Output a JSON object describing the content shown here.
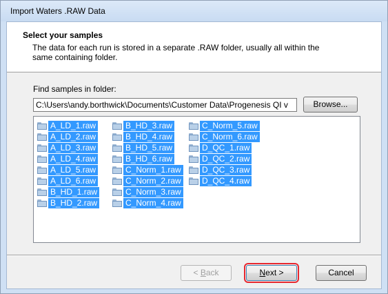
{
  "window": {
    "title": "Import Waters .RAW Data"
  },
  "header": {
    "title": "Select your samples",
    "description": "The data for each run is stored in a separate .RAW folder, usually all within the same containing folder."
  },
  "folder": {
    "label": "Find samples in folder:",
    "value": "C:\\Users\\andy.borthwick\\Documents\\Customer Data\\Progenesis QI v",
    "browse_label": "Browse..."
  },
  "samples": {
    "columns": [
      [
        "A_LD_1.raw",
        "A_LD_2.raw",
        "A_LD_3.raw",
        "A_LD_4.raw",
        "A_LD_5.raw",
        "A_LD_6.raw",
        "B_HD_1.raw",
        "B_HD_2.raw"
      ],
      [
        "B_HD_3.raw",
        "B_HD_4.raw",
        "B_HD_5.raw",
        "B_HD_6.raw",
        "C_Norm_1.raw",
        "C_Norm_2.raw",
        "C_Norm_3.raw",
        "C_Norm_4.raw"
      ],
      [
        "C_Norm_5.raw",
        "C_Norm_6.raw",
        "D_QC_1.raw",
        "D_QC_2.raw",
        "D_QC_3.raw",
        "D_QC_4.raw"
      ]
    ],
    "icon": "folder-icon",
    "selected": true,
    "selection_color": "#3399ff"
  },
  "buttons": {
    "back": {
      "prefix": "< ",
      "mnemonic": "B",
      "rest": "ack"
    },
    "next": {
      "mnemonic": "N",
      "rest": "ext >"
    },
    "cancel": "Cancel"
  },
  "highlight": {
    "target": "next-button",
    "color": "#e8282f"
  }
}
